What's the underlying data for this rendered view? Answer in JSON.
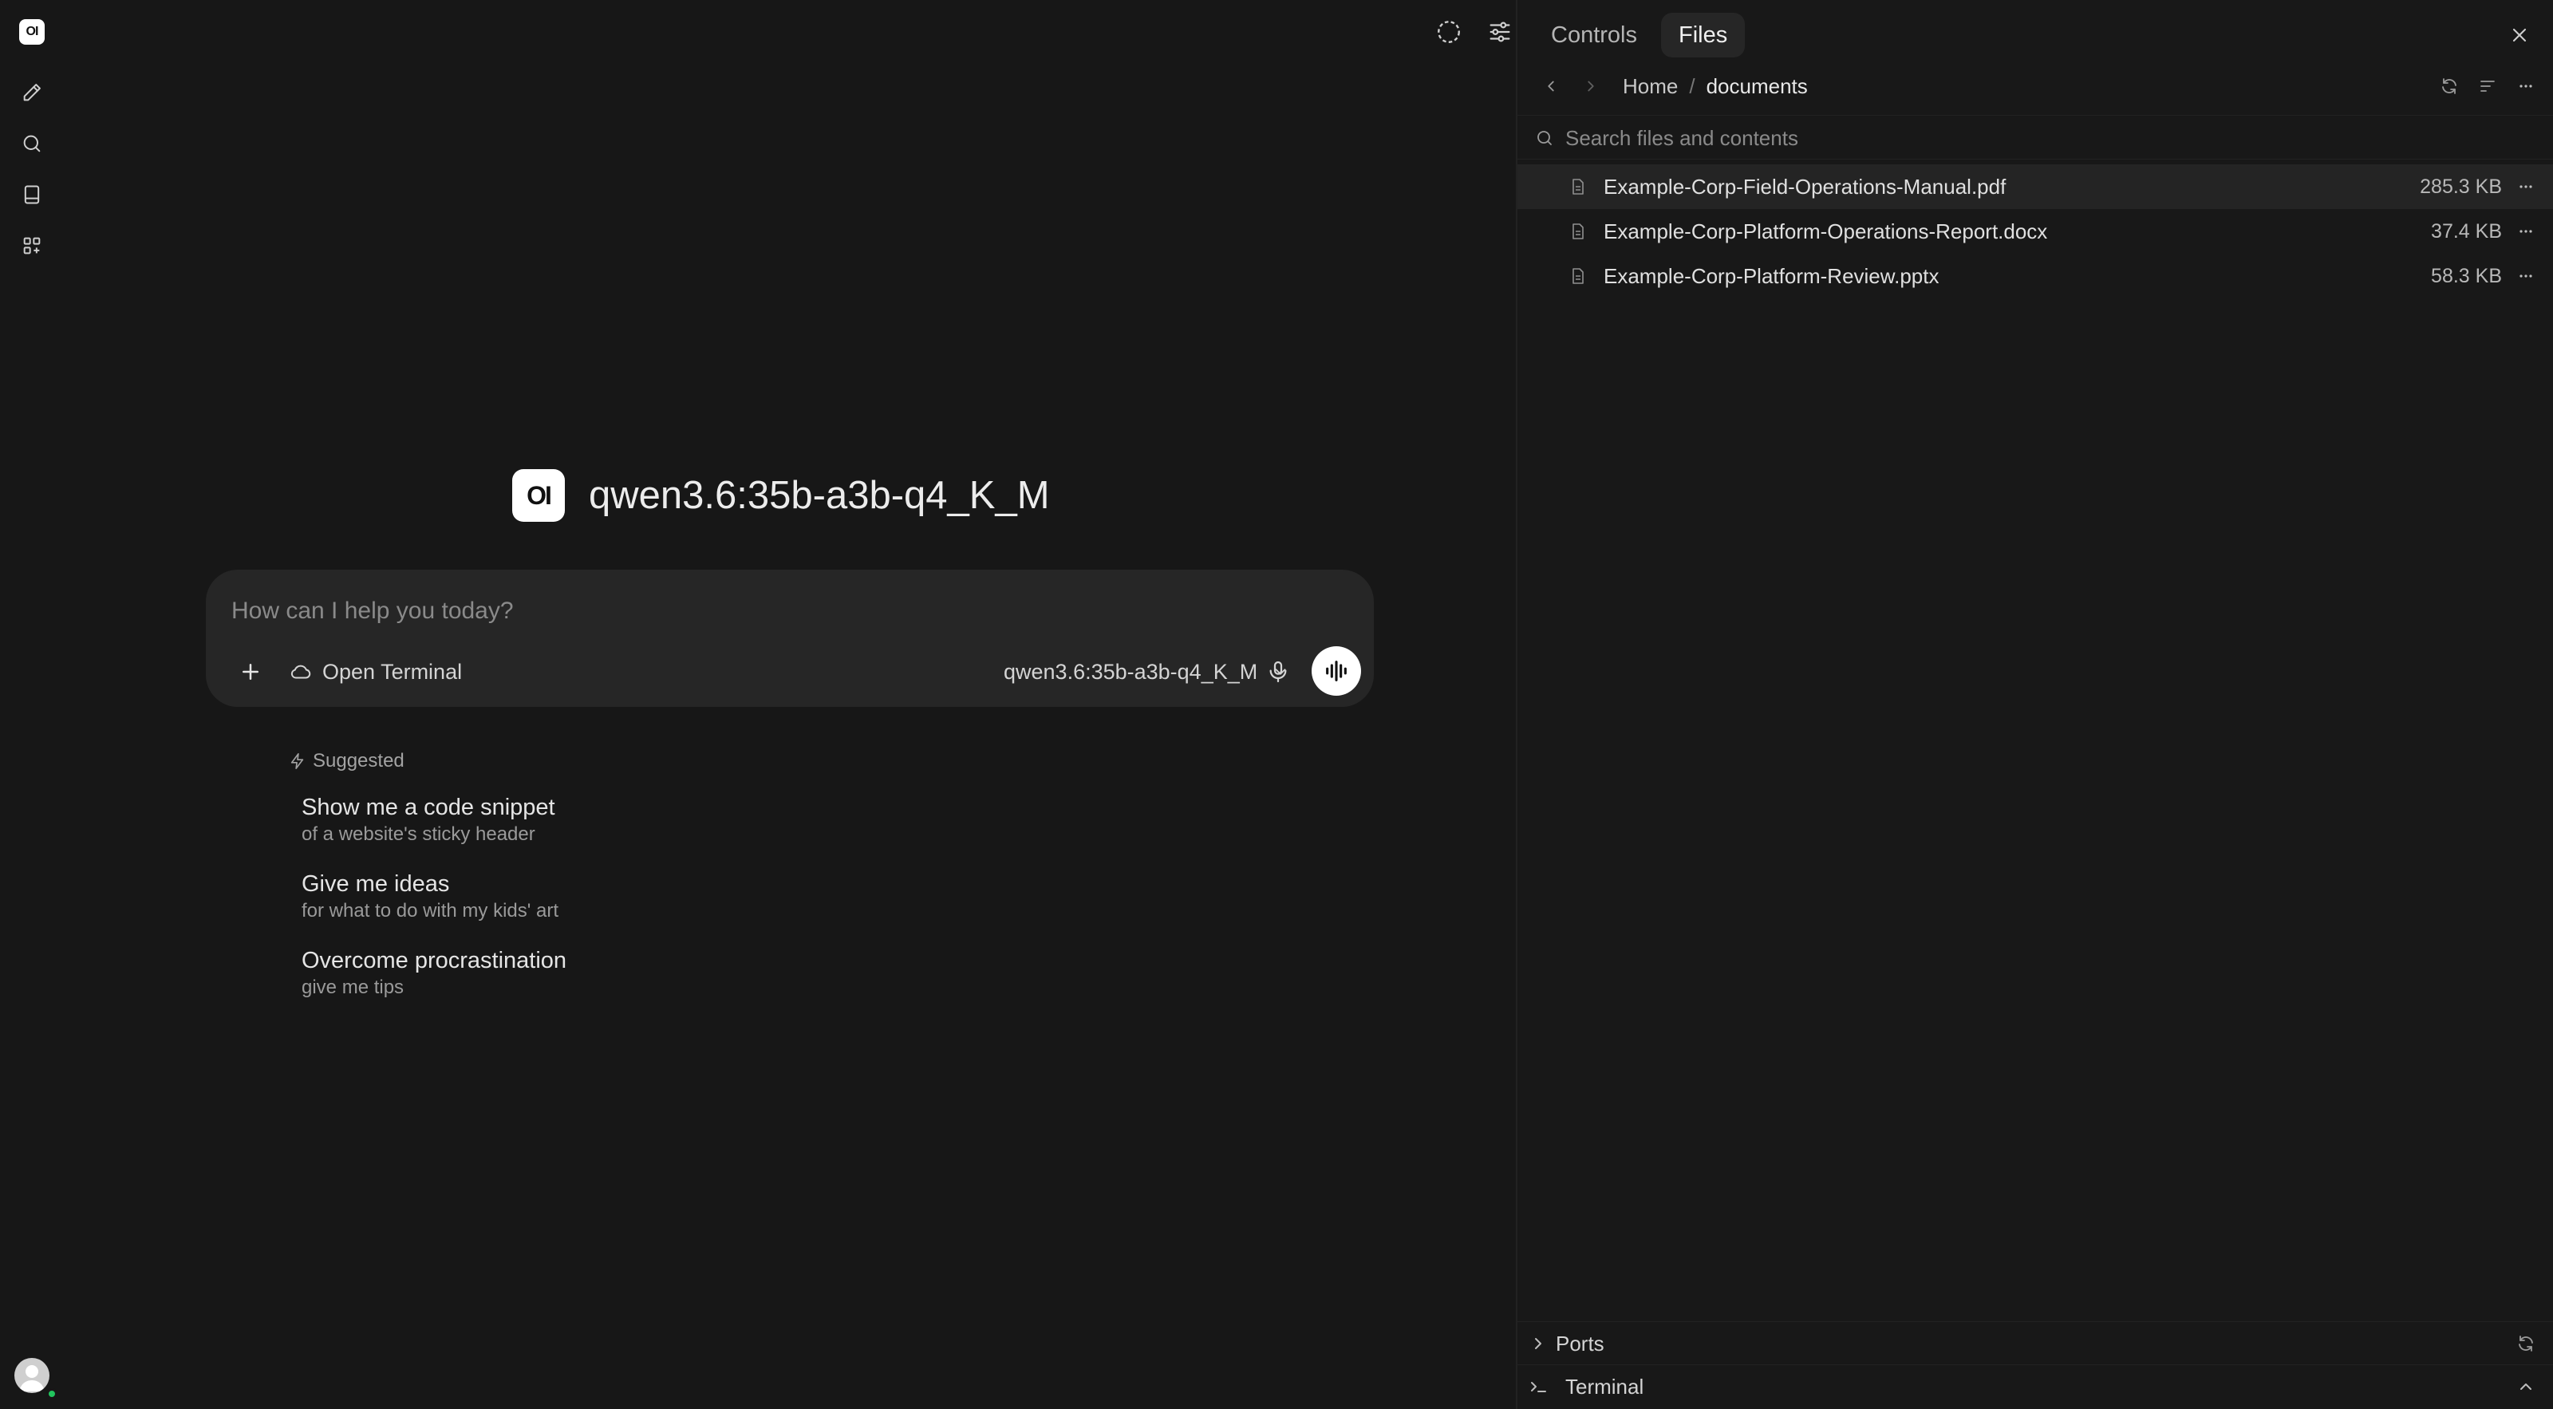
{
  "app": {
    "logo_text": "OI",
    "accent": "#ffffff",
    "status_color": "#22c55e"
  },
  "rail": {
    "items": [
      {
        "name": "new-chat",
        "icon": "pencil-icon"
      },
      {
        "name": "search",
        "icon": "search-icon"
      },
      {
        "name": "notes",
        "icon": "notebook-icon"
      },
      {
        "name": "workspace",
        "icon": "apps-icon"
      }
    ]
  },
  "hero": {
    "model_name": "qwen3.6:35b-a3b-q4_K_M"
  },
  "composer": {
    "placeholder": "How can I help you today?",
    "terminal_label": "Open Terminal",
    "model_selected": "qwen3.6:35b-a3b-q4_K_M"
  },
  "suggested": {
    "heading": "Suggested",
    "items": [
      {
        "title": "Show me a code snippet",
        "subtitle": "of a website's sticky header"
      },
      {
        "title": "Give me ideas",
        "subtitle": "for what to do with my kids' art"
      },
      {
        "title": "Overcome procrastination",
        "subtitle": "give me tips"
      }
    ]
  },
  "panel": {
    "tabs": [
      "Controls",
      "Files"
    ],
    "active_tab": "Files",
    "breadcrumb": [
      "Home",
      "documents"
    ],
    "breadcrumb_separator": "/",
    "search_placeholder": "Search files and contents",
    "files": [
      {
        "name": "Example-Corp-Field-Operations-Manual.pdf",
        "size": "285.3 KB",
        "selected": true
      },
      {
        "name": "Example-Corp-Platform-Operations-Report.docx",
        "size": "37.4 KB",
        "selected": false
      },
      {
        "name": "Example-Corp-Platform-Review.pptx",
        "size": "58.3 KB",
        "selected": false
      }
    ],
    "ports_label": "Ports",
    "terminal_label": "Terminal"
  }
}
